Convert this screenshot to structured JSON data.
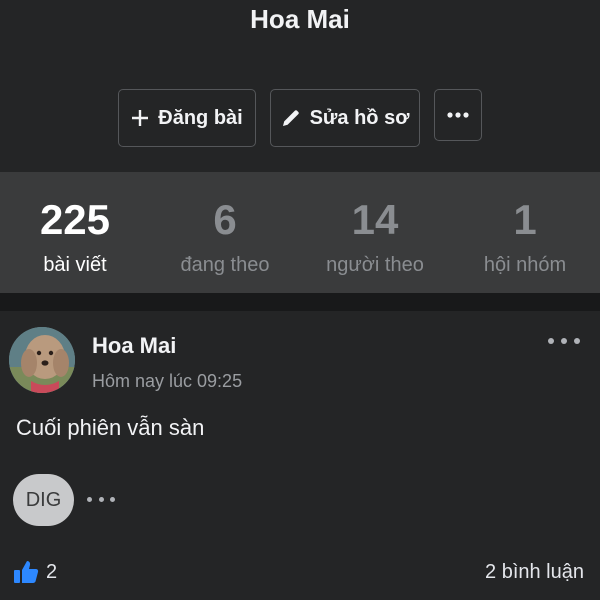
{
  "profile": {
    "name": "Hoa Mai"
  },
  "actions": {
    "post_label": "Đăng bài",
    "edit_label": "Sửa hồ sơ"
  },
  "stats": [
    {
      "value": "225",
      "label": "bài viết"
    },
    {
      "value": "6",
      "label": "đang theo"
    },
    {
      "value": "14",
      "label": "người theo"
    },
    {
      "value": "1",
      "label": "hội nhóm"
    }
  ],
  "post": {
    "author": "Hoa Mai",
    "time": "Hôm nay lúc 09:25",
    "text": "Cuối phiên vẫn sàn",
    "reaction_badge": "DIG",
    "likes": "2",
    "comments": "2 bình luận"
  },
  "icons": {
    "plus": "plus-icon",
    "edit": "pencil-icon",
    "more": "more-horizontal-icon",
    "like": "thumbs-up-icon"
  },
  "colors": {
    "background": "#242526",
    "stats_bar": "#3a3b3c",
    "like_blue": "#2d88ff"
  }
}
